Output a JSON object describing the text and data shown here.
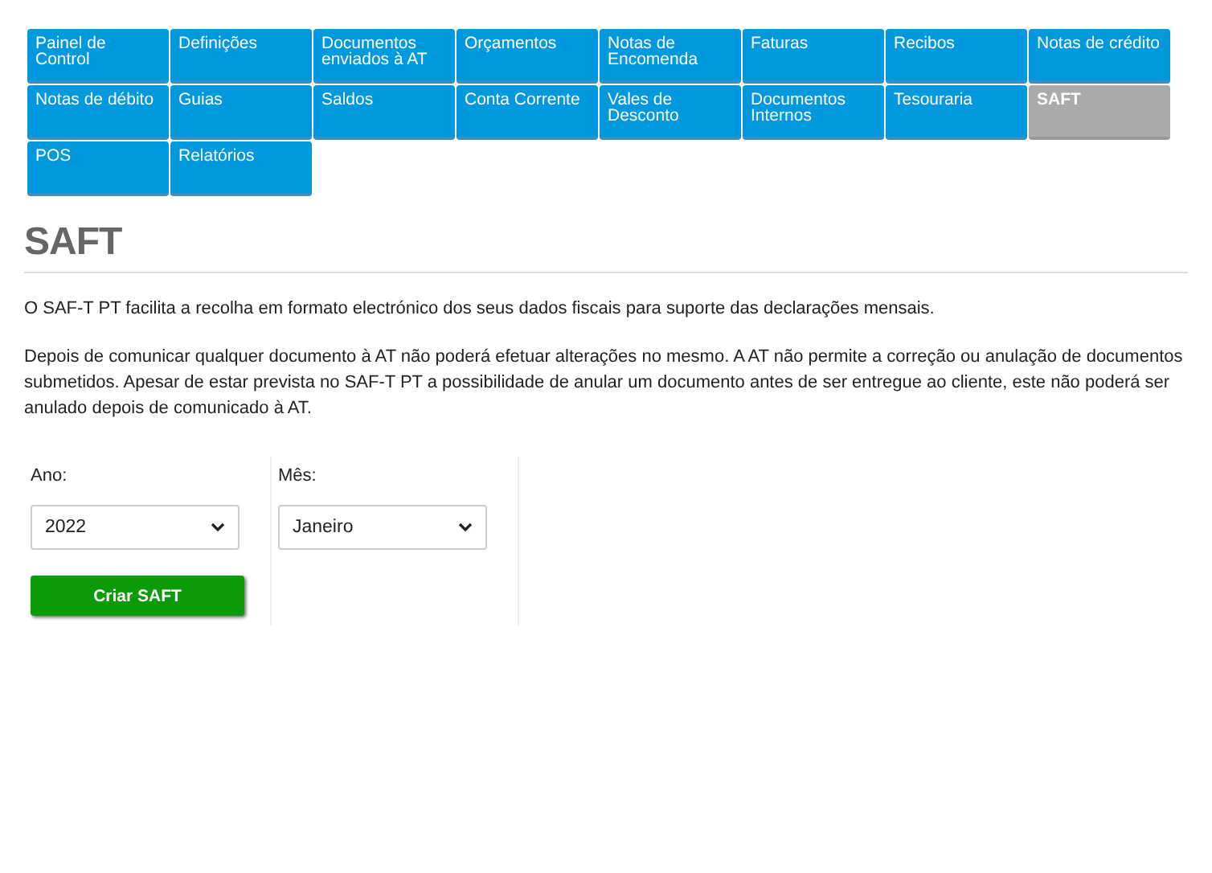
{
  "menu": [
    {
      "label": "Painel de Control",
      "selected": false
    },
    {
      "label": "Definições",
      "selected": false
    },
    {
      "label": "Documentos enviados à AT",
      "selected": false
    },
    {
      "label": "Orçamentos",
      "selected": false
    },
    {
      "label": "Notas de Encomenda",
      "selected": false
    },
    {
      "label": "Faturas",
      "selected": false
    },
    {
      "label": "Recibos",
      "selected": false
    },
    {
      "label": "Notas de crédito",
      "selected": false
    },
    {
      "label": "Notas de débito",
      "selected": false
    },
    {
      "label": "Guias",
      "selected": false
    },
    {
      "label": "Saldos",
      "selected": false
    },
    {
      "label": "Conta Corrente",
      "selected": false
    },
    {
      "label": "Vales de Desconto",
      "selected": false
    },
    {
      "label": "Documentos Internos",
      "selected": false
    },
    {
      "label": "Tesouraria",
      "selected": false
    },
    {
      "label": "SAFT",
      "selected": true
    },
    {
      "label": "POS",
      "selected": false
    },
    {
      "label": "Relatórios",
      "selected": false
    }
  ],
  "title": "SAFT",
  "paragraphs": [
    "O SAF-T PT facilita a recolha em formato electrónico dos seus dados fiscais para suporte das declarações mensais.",
    "Depois de comunicar qualquer documento à AT não poderá efetuar alterações no mesmo. A AT não permite a correção ou anulação de documentos submetidos. Apesar de estar prevista no SAF-T PT a possibilidade de anular um documento antes de ser entregue ao cliente, este não poderá ser anulado depois de comunicado à AT."
  ],
  "form": {
    "year": {
      "label": "Ano:",
      "value": "2022"
    },
    "month": {
      "label": "Mês:",
      "value": "Janeiro"
    },
    "button": "Criar SAFT"
  }
}
